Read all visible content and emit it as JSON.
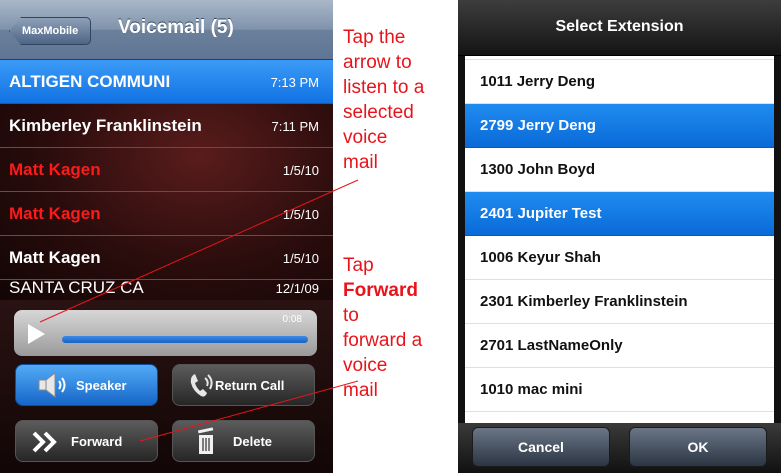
{
  "left_screen": {
    "back_button": "MaxMobile",
    "title": "Voicemail (5)",
    "voicemails": [
      {
        "name": "ALTIGEN COMMUNI",
        "time": "7:13 PM"
      },
      {
        "name": "Kimberley Franklinstein",
        "time": "7:11 PM"
      },
      {
        "name": "Matt Kagen",
        "time": "1/5/10"
      },
      {
        "name": "Matt Kagen",
        "time": "1/5/10"
      },
      {
        "name": "Matt Kagen",
        "time": "1/5/10"
      },
      {
        "name": "SANTA CRUZ  CA",
        "time": "12/1/09"
      }
    ],
    "player": {
      "time": "0:08"
    },
    "buttons": {
      "speaker": "Speaker",
      "return_call": "Return Call",
      "forward": "Forward",
      "delete": "Delete"
    }
  },
  "annotations": {
    "listen": [
      "Tap the",
      "arrow to",
      "listen to a",
      "selected",
      "voice",
      "mail"
    ],
    "forward_line1": "Tap",
    "forward_bold": "Forward",
    "forward_rest": [
      "to",
      "forward a",
      "voice",
      "mail"
    ]
  },
  "right_screen": {
    "title": "Select Extension",
    "extensions": [
      "1011 Jerry Deng",
      "2799 Jerry Deng",
      "1300 John Boyd",
      "2401 Jupiter Test",
      "1006 Keyur Shah",
      "2301 Kimberley Franklinstein",
      "2701 LastNameOnly",
      "1010 mac mini"
    ],
    "cancel_button": "Cancel",
    "ok_button": "OK"
  },
  "colors": {
    "selection_blue": "#1172e4",
    "annotation_red": "#e8141b",
    "missed_red": "#ff1a1a"
  },
  "icons": [
    "speaker-icon",
    "return-call-icon",
    "forward-icon",
    "trash-icon",
    "play-icon"
  ]
}
